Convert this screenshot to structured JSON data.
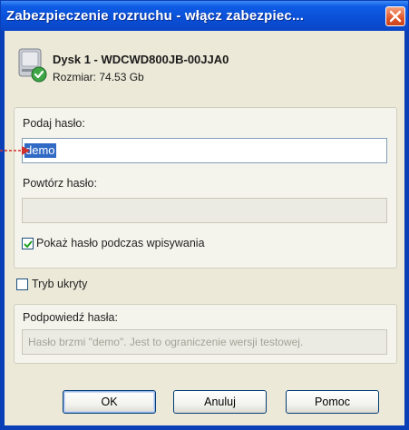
{
  "window": {
    "title": "Zabezpieczenie rozruchu - włącz zabezpiec...",
    "close_icon": "close-icon"
  },
  "disk": {
    "icon": "hard-disk-check-icon",
    "name": "Dysk 1 - WDCWD800JB-00JJA0",
    "size": "Rozmiar: 74.53 Gb"
  },
  "password": {
    "label": "Podaj hasło:",
    "value": "demo",
    "repeat_label": "Powtórz hasło:",
    "repeat_value": "",
    "show_password_label": "Pokaż hasło podczas wpisywania",
    "show_password_checked": true
  },
  "hidden_mode": {
    "label": "Tryb ukryty",
    "checked": false
  },
  "hint": {
    "label": "Podpowiedź hasła:",
    "value": "Hasło brzmi \"demo\". Jest to ograniczenie wersji testowej."
  },
  "buttons": {
    "ok": "OK",
    "cancel": "Anuluj",
    "help": "Pomoc"
  },
  "colors": {
    "titlebar": "#0a4fd6",
    "client": "#ece9d8",
    "selection": "#316ac5",
    "arrow": "#d0312d"
  }
}
